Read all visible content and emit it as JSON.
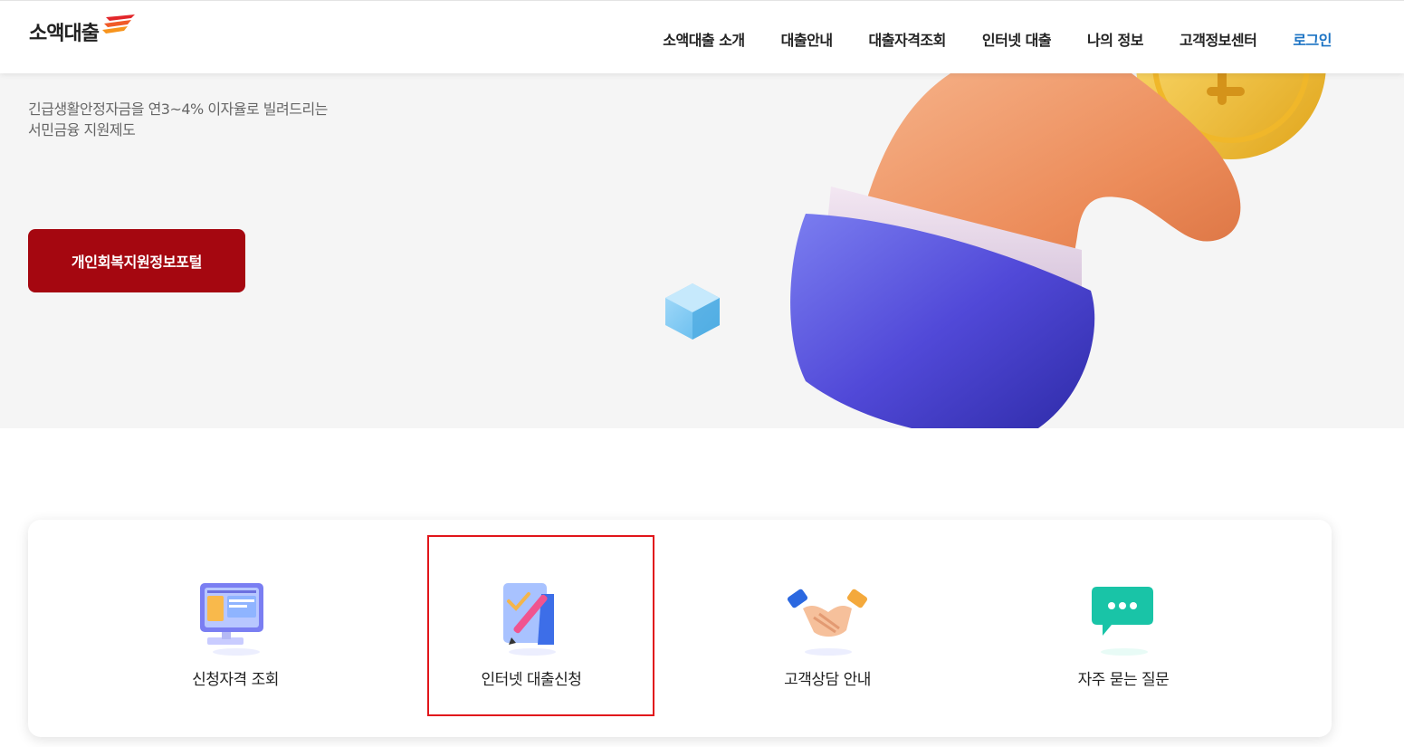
{
  "header": {
    "logo_text": "소액대출",
    "nav": [
      "소액대출 소개",
      "대출안내",
      "대출자격조회",
      "인터넷 대출",
      "나의 정보",
      "고객정보센터"
    ],
    "login_label": "로그인",
    "login_color": "#1d74c4"
  },
  "hero": {
    "line1": "긴급생활안정자금을 연3~4% 이자율로 빌려드리는",
    "line2": "서민금융 지원제도",
    "button_label": "개인회복지원정보포털",
    "button_color": "#a50710"
  },
  "quick_menu": {
    "items": [
      {
        "label": "신청자격 조회",
        "icon": "monitor-icon"
      },
      {
        "label": "인터넷 대출신청",
        "icon": "document-pen-icon"
      },
      {
        "label": "고객상담 안내",
        "icon": "handshake-icon"
      },
      {
        "label": "자주 묻는 질문",
        "icon": "chat-bubble-icon"
      }
    ],
    "highlight_color": "#e1161b"
  }
}
